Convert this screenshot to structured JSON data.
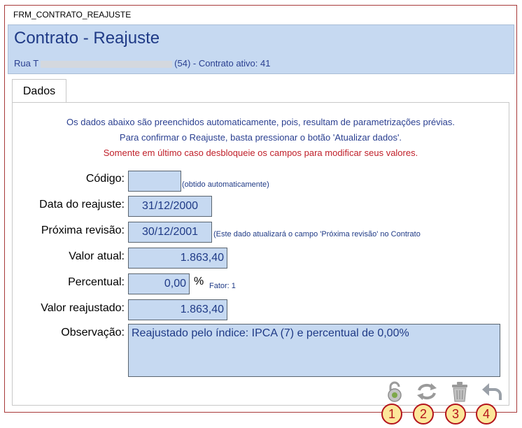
{
  "window": {
    "title": "FRM_CONTRATO_REAJUSTE"
  },
  "header": {
    "title": "Contrato - Reajuste",
    "subtitle_start": "Rua T",
    "subtitle_end": "(54) - Contrato ativo: 41"
  },
  "tabs": [
    {
      "label": "Dados"
    }
  ],
  "notices": {
    "line1": "Os dados abaixo são preenchidos automaticamente, pois, resultam de parametrizações prévias.",
    "line2": "Para confirmar o Reajuste, basta pressionar o botão 'Atualizar dados'.",
    "line3": "Somente em último caso desbloqueie os campos para modificar seus valores."
  },
  "form": {
    "codigo": {
      "label": "Código:",
      "value": "",
      "hint": "(obtido automaticamente)"
    },
    "data_reajuste": {
      "label": "Data do reajuste:",
      "value": "31/12/2000"
    },
    "proxima_revisao": {
      "label": "Próxima revisão:",
      "value": "30/12/2001",
      "hint": "(Este dado atualizará o campo 'Próxima revisão' no Contrato"
    },
    "valor_atual": {
      "label": "Valor atual:",
      "value": "1.863,40"
    },
    "percentual": {
      "label": "Percentual:",
      "value": "0,00",
      "unit": "%",
      "hint": "Fator: 1"
    },
    "valor_reajustado": {
      "label": "Valor reajustado:",
      "value": "1.863,40"
    },
    "observacao": {
      "label": "Observação:",
      "value": "Reajustado pelo índice: IPCA (7) e percentual de 0,00%"
    }
  },
  "toolbar": {
    "buttons": [
      {
        "icon": "unlock-icon",
        "badge": "1"
      },
      {
        "icon": "refresh-icon",
        "badge": "2"
      },
      {
        "icon": "trash-icon",
        "badge": "3"
      },
      {
        "icon": "undo-icon",
        "badge": "4"
      }
    ]
  },
  "colors": {
    "header_bg": "#c6d9f1",
    "field_bg": "#c6d9f1",
    "text_blue": "#1f3a86",
    "warning_red": "#c0202a",
    "frame_border": "#a83a3a",
    "badge_fill": "#fce79a",
    "badge_border": "#b4141c"
  }
}
